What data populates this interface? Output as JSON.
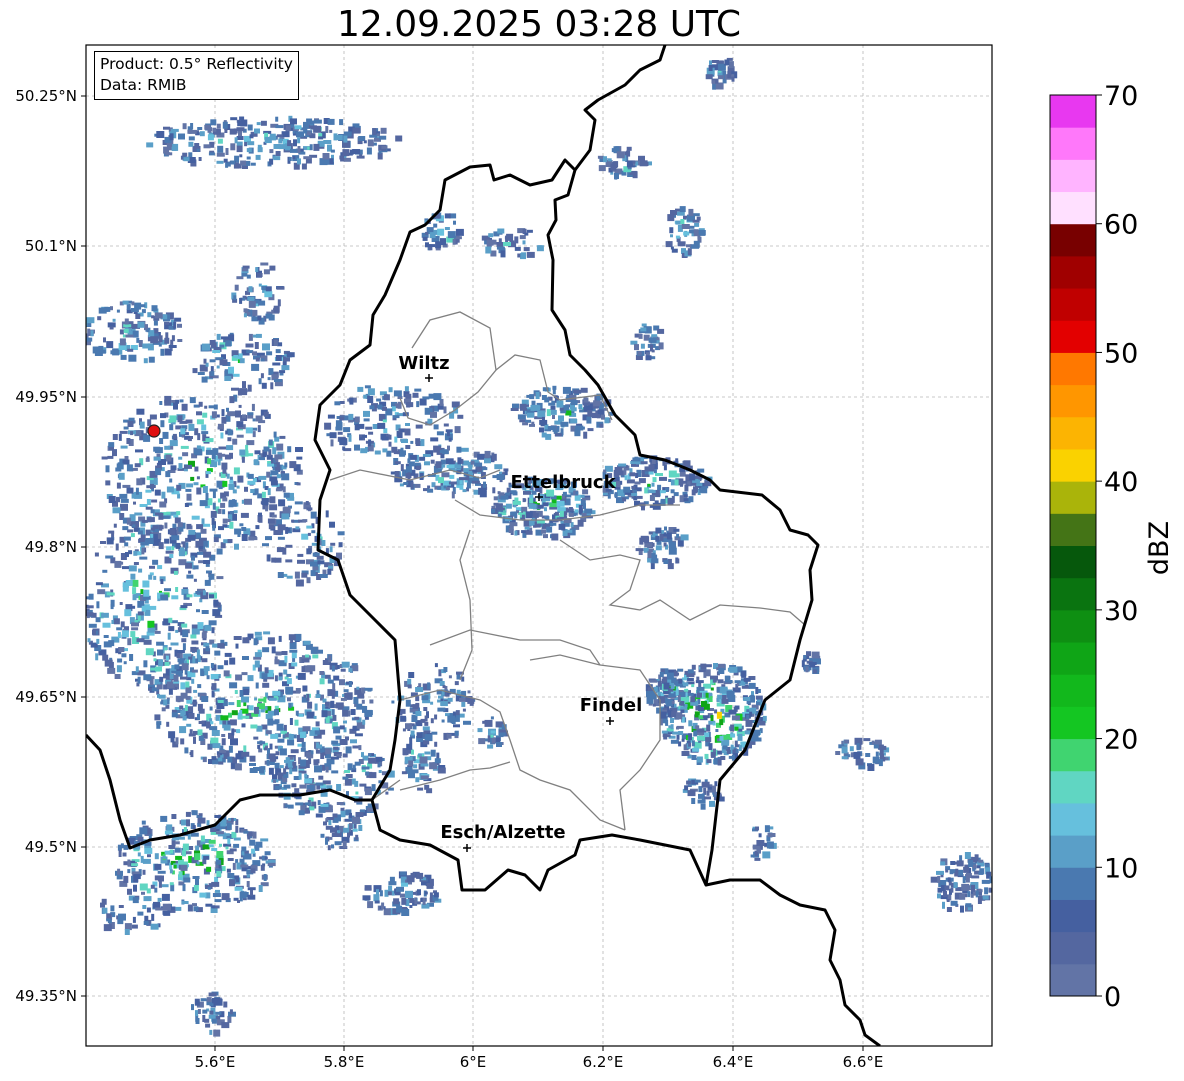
{
  "title": "12.09.2025 03:28 UTC",
  "info": {
    "product": "Product: 0.5° Reflectivity",
    "data": "Data: RMIB"
  },
  "axes": {
    "lon_ticks": [
      "5.6°E",
      "5.8°E",
      "6°E",
      "6.2°E",
      "6.4°E",
      "6.6°E"
    ],
    "lat_ticks": [
      "50.25°N",
      "50.1°N",
      "49.95°N",
      "49.8°N",
      "49.65°N",
      "49.5°N",
      "49.35°N"
    ]
  },
  "cities": [
    {
      "name": "Wiltz"
    },
    {
      "name": "Ettelbruck"
    },
    {
      "name": "Findel"
    },
    {
      "name": "Esch/Alzette"
    }
  ],
  "colorbar": {
    "label": "dBZ",
    "ticks": [
      "0",
      "10",
      "20",
      "30",
      "40",
      "50",
      "60",
      "70"
    ],
    "colors": [
      "#6274a6",
      "#5467a0",
      "#4560a0",
      "#4a79b0",
      "#5a9fc8",
      "#66c0dd",
      "#60d6c2",
      "#40d470",
      "#14c622",
      "#12b81c",
      "#0fa516",
      "#0e8f12",
      "#0a7410",
      "#06580c",
      "#447416",
      "#aab40a",
      "#fad200",
      "#fcb402",
      "#ff9600",
      "#ff7800",
      "#e30000",
      "#c00000",
      "#a00000",
      "#780000",
      "#ffe0ff",
      "#ffb4ff",
      "#ff78fa",
      "#e838f0"
    ]
  },
  "radar_site": {
    "color": "#e01010"
  }
}
